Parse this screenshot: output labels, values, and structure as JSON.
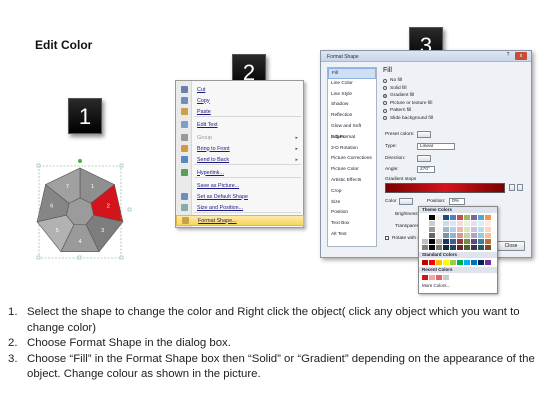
{
  "title": "Edit Color",
  "badges": [
    "1",
    "2",
    "3"
  ],
  "shape": {
    "segments": [
      "1",
      "2",
      "3",
      "4",
      "5",
      "6",
      "7"
    ],
    "highlight_color": "#d4141b"
  },
  "context_menu": {
    "items": [
      {
        "label": "Cut",
        "icon": "scissors-icon"
      },
      {
        "label": "Copy",
        "icon": "copy-icon"
      },
      {
        "label": "Paste",
        "icon": "paste-icon"
      },
      {
        "label": "Edit Text",
        "icon": "edit-text-icon"
      },
      {
        "label": "Group",
        "icon": "group-icon",
        "disabled": true
      },
      {
        "label": "Bring to Front",
        "icon": "bring-front-icon"
      },
      {
        "label": "Send to Back",
        "icon": "send-back-icon"
      },
      {
        "label": "Hyperlink...",
        "icon": "hyperlink-icon"
      },
      {
        "label": "Save as Picture...",
        "icon": ""
      },
      {
        "label": "Set as Default Shape",
        "icon": "default-shape-icon"
      },
      {
        "label": "Size and Position...",
        "icon": "size-position-icon"
      },
      {
        "label": "Format Shape...",
        "icon": "format-shape-icon"
      }
    ]
  },
  "dialog": {
    "title": "Format Shape",
    "help": "?",
    "close_x": "x",
    "categories": [
      "Fill",
      "Line Color",
      "Line Style",
      "Shadow",
      "Reflection",
      "Glow and Soft Edges",
      "3-D Format",
      "3-D Rotation",
      "Picture Corrections",
      "Picture Color",
      "Artistic Effects",
      "Crop",
      "Size",
      "Position",
      "Text Box",
      "Alt Text"
    ],
    "fill_header": "Fill",
    "options": [
      "No fill",
      "Solid fill",
      "Gradient fill",
      "Picture or texture fill",
      "Pattern fill",
      "Slide background fill"
    ],
    "preset_label": "Preset colors:",
    "type_label": "Type:",
    "type_value": "Linear",
    "direction_label": "Direction:",
    "angle_label": "Angle:",
    "angle_value": "270°",
    "gradient_stops_label": "Gradient stops",
    "color_label": "Color",
    "position_label": "Position:",
    "position_value": "0%",
    "brightness_label": "Brightness:",
    "transparency_label": "Transparency:",
    "rotate_label": "Rotate with shape",
    "close_button": "Close"
  },
  "palette": {
    "theme_label": "Theme Colors",
    "standard_label": "Standard Colors",
    "recent_label": "Recent Colors",
    "more_label": "More Colors...",
    "theme_top": [
      "#ffffff",
      "#000000",
      "#eeece1",
      "#1f497d",
      "#4f81bd",
      "#c0504d",
      "#9bbb59",
      "#8064a2",
      "#4bacc6",
      "#f79646"
    ],
    "standard": [
      "#c00000",
      "#ff0000",
      "#ffc000",
      "#ffff00",
      "#92d050",
      "#00b050",
      "#00b0f0",
      "#0070c0",
      "#002060",
      "#7030a0"
    ],
    "recent": [
      "#d4141b",
      "#f4a6a6",
      "#e06666",
      "#c9c9c9"
    ]
  },
  "steps": [
    "Select the shape to change the color and Right click the object( click any object which you want to change color)",
    "Choose Format Shape in the dialog box.",
    "Choose “Fill” in the Format Shape box then “Solid” or “Gradient” depending on the appearance of the object. Change colour as shown in the picture."
  ]
}
